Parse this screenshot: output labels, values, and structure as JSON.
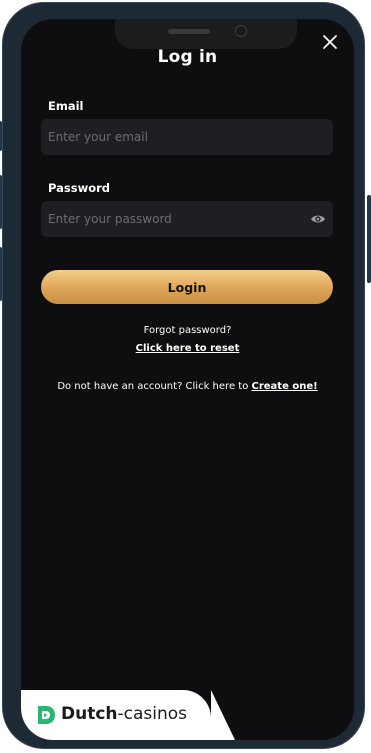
{
  "header": {
    "title": "Log in",
    "close_icon": "close-icon"
  },
  "form": {
    "email_label": "Email",
    "email_placeholder": "Enter your email",
    "email_value": "",
    "password_label": "Password",
    "password_placeholder": "Enter your password",
    "password_value": "",
    "password_toggle_icon": "eye-icon",
    "login_label": "Login"
  },
  "links": {
    "forgot_text": "Forgot password?",
    "reset_link": "Click here to reset",
    "signup_text": "Do not have an account? Click here to",
    "signup_link": "Create one!"
  },
  "watermark": {
    "brand_bold": "Dutch",
    "brand_rest": "-casinos",
    "logo_icon": "dutch-casinos-logo-icon"
  },
  "colors": {
    "background": "#0e0e10",
    "field": "#1f1f23",
    "button_gold": "#e0a85a",
    "logo_green": "#2bb673"
  }
}
